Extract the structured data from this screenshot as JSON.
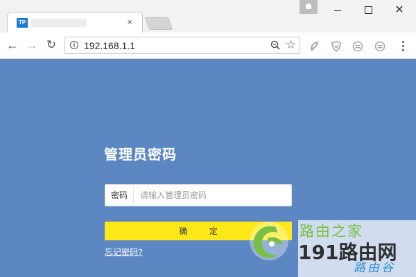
{
  "browser": {
    "tab": {
      "favicon_text": "TP",
      "close_symbol": "×"
    },
    "window_controls": {
      "minimize": "minimize",
      "maximize": "maximize",
      "close_symbol": "✕"
    },
    "toolbar": {
      "back_symbol": "←",
      "forward_symbol": "→",
      "reload_symbol": "↻",
      "url": "192.168.1.1",
      "info_symbol": "i",
      "star_symbol": "☆"
    },
    "icons": [
      "back-arrow-icon",
      "forward-arrow-icon",
      "reload-icon",
      "info-icon",
      "zoom-icon",
      "star-icon",
      "extension-icon",
      "shield-icon",
      "menu-dots-icon"
    ]
  },
  "login": {
    "title": "管理员密码",
    "password_label": "密码",
    "password_placeholder": "请输入管理员密码",
    "password_value": "",
    "confirm_label": "确 定",
    "forgot_link": "忘记密码?"
  },
  "watermark": {
    "line1": "路由之家",
    "line2": "191路由网",
    "line3": "路由谷"
  },
  "colors": {
    "page_background": "#5c87c2",
    "button_yellow": "#ffe81a",
    "favicon_blue": "#1b7bd1",
    "watermark_green": "#77c043",
    "watermark_blue": "#2c8fd8"
  }
}
